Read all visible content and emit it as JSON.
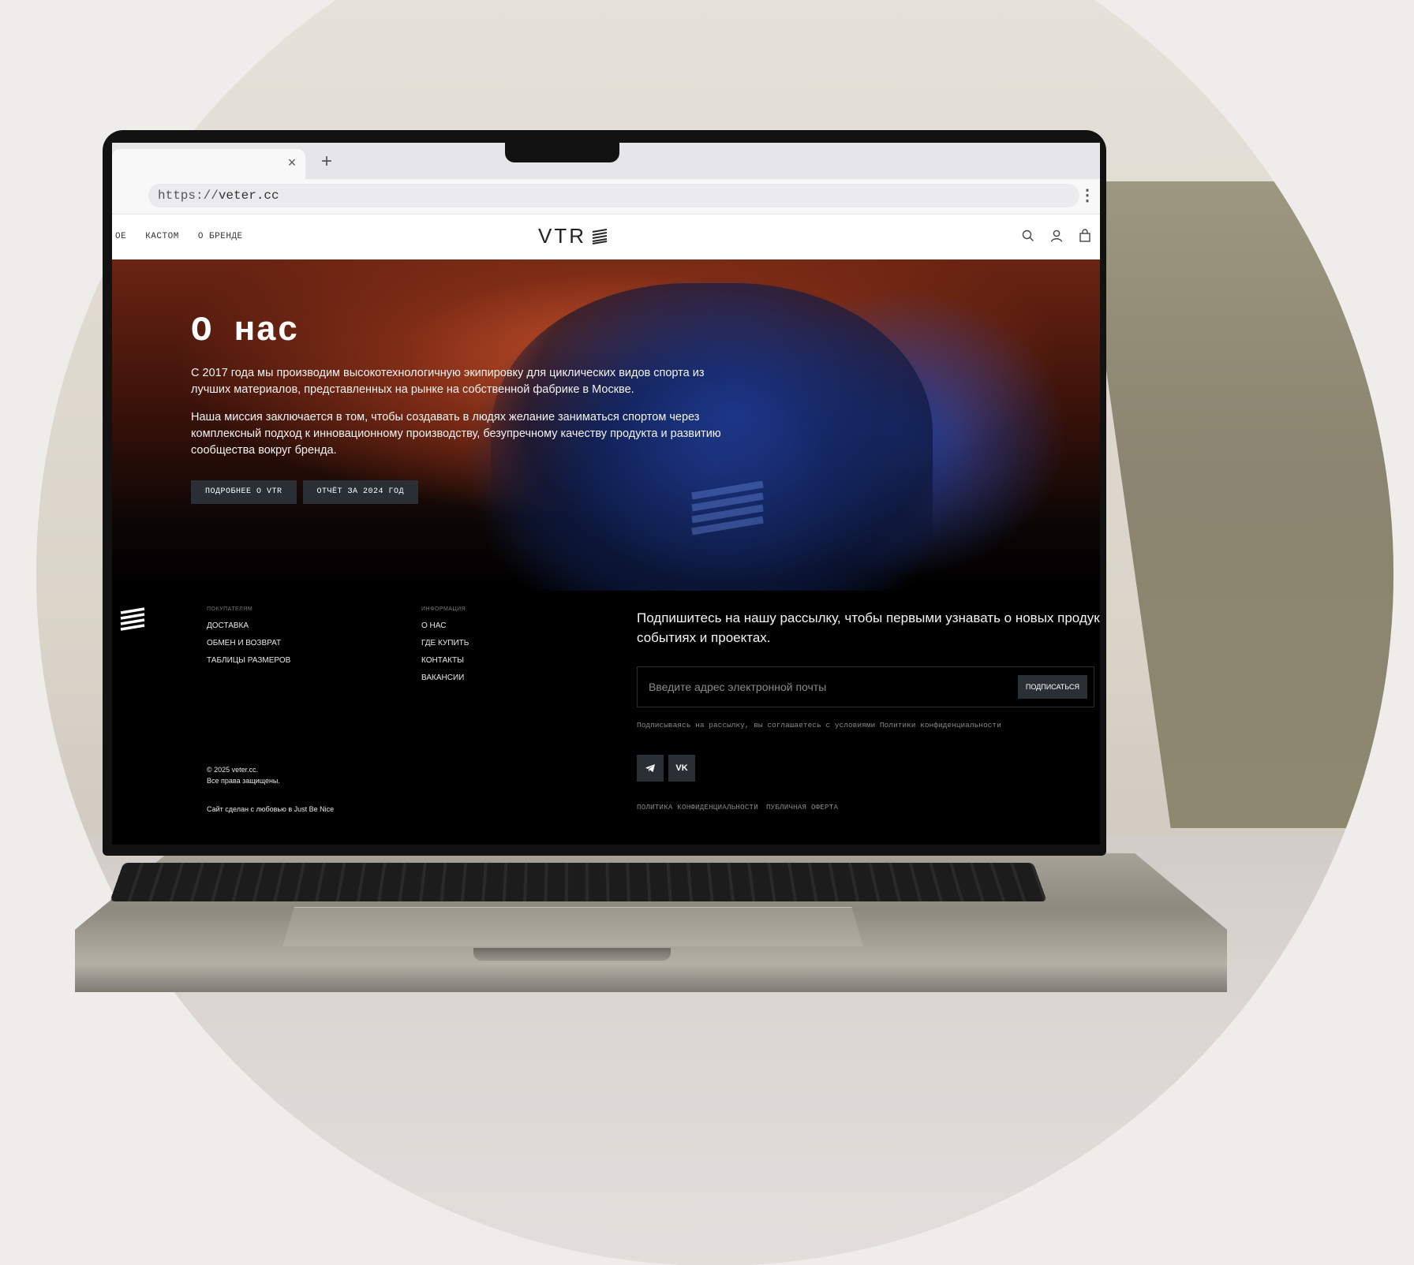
{
  "browser": {
    "tab_close": "×",
    "tab_new": "+",
    "url_scheme": "https://",
    "url_host": "veter.cc",
    "menu_icon": "⋮"
  },
  "header": {
    "nav": [
      "ОЕ",
      "КАСТОМ",
      "О БРЕНДЕ"
    ],
    "logo_text": "VTR",
    "icons": [
      "search-icon",
      "user-icon",
      "bag-icon"
    ]
  },
  "hero": {
    "title": "О нас",
    "paragraph_1": "С 2017 года мы производим высокотехнологичную экипировку для циклических видов спорта из лучших материалов, представленных на рынке на собственной фабрике в Москве.",
    "paragraph_2": "Наша миссия заключается в том, чтобы создавать в людях желание заниматься спортом через комплексный подход к инновационному производству, безупречному качеству продукта и развитию сообщества вокруг бренда.",
    "button_more": "ПОДРОБНЕЕ О VTR",
    "button_report": "ОТЧЁТ ЗА 2024 ГОД"
  },
  "footer": {
    "col_buyers": {
      "heading": "ПОКУПАТЕЛЯМ",
      "links": [
        "ДОСТАВКА",
        "ОБМЕН И ВОЗВРАТ",
        "ТАБЛИЦЫ РАЗМЕРОВ"
      ]
    },
    "col_info": {
      "heading": "ИНФОРМАЦИЯ",
      "links": [
        "О НАС",
        "ГДЕ КУПИТЬ",
        "КОНТАКТЫ",
        "ВАКАНСИИ"
      ]
    },
    "subscribe_text": "Подпишитесь на нашу рассылку, чтобы первыми узнавать о новых продуктах, событиях и проектах.",
    "email_placeholder": "Введите адрес электронной почты",
    "subscribe_button": "ПОДПИСАТЬСЯ",
    "consent": "Подписываясь на рассылку, вы соглашаетесь с условиями Политики конфиденциальности",
    "socials": [
      "telegram-icon",
      "vk-icon"
    ],
    "vk_label": "VK",
    "copyright_line1": "© 2025 veter.cc.",
    "copyright_line2": "Все права защищены.",
    "made_by": "Сайт сделан с любовью в Just Be Nice",
    "legal_privacy": "ПОЛИТИКА КОНФИДЕНЦИАЛЬНОСТИ",
    "legal_offer": "ПУБЛИЧНАЯ ОФЕРТА"
  }
}
